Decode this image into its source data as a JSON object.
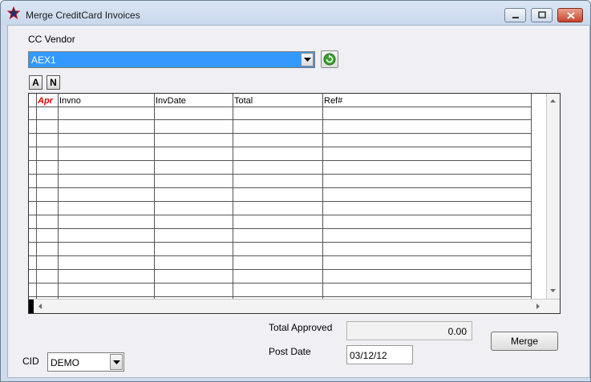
{
  "window": {
    "title": "Merge CreditCard Invoices"
  },
  "vendor": {
    "label": "CC Vendor",
    "selected": "AEX1"
  },
  "toolbar": {
    "approve_all_label": "A",
    "approve_none_label": "N"
  },
  "grid": {
    "columns": [
      "Apr",
      "Invno",
      "InvDate",
      "Total",
      "Ref#"
    ],
    "rows": []
  },
  "totals": {
    "approved_label": "Total Approved",
    "approved_value": "0.00",
    "post_date_label": "Post Date",
    "post_date_value": "03/12/12"
  },
  "actions": {
    "merge_label": "Merge"
  },
  "cid": {
    "label": "CID",
    "selected": "DEMO"
  },
  "colors": {
    "selection": "#3399ff",
    "apr_header": "#e00000",
    "refresh_green": "#3aa32b"
  }
}
